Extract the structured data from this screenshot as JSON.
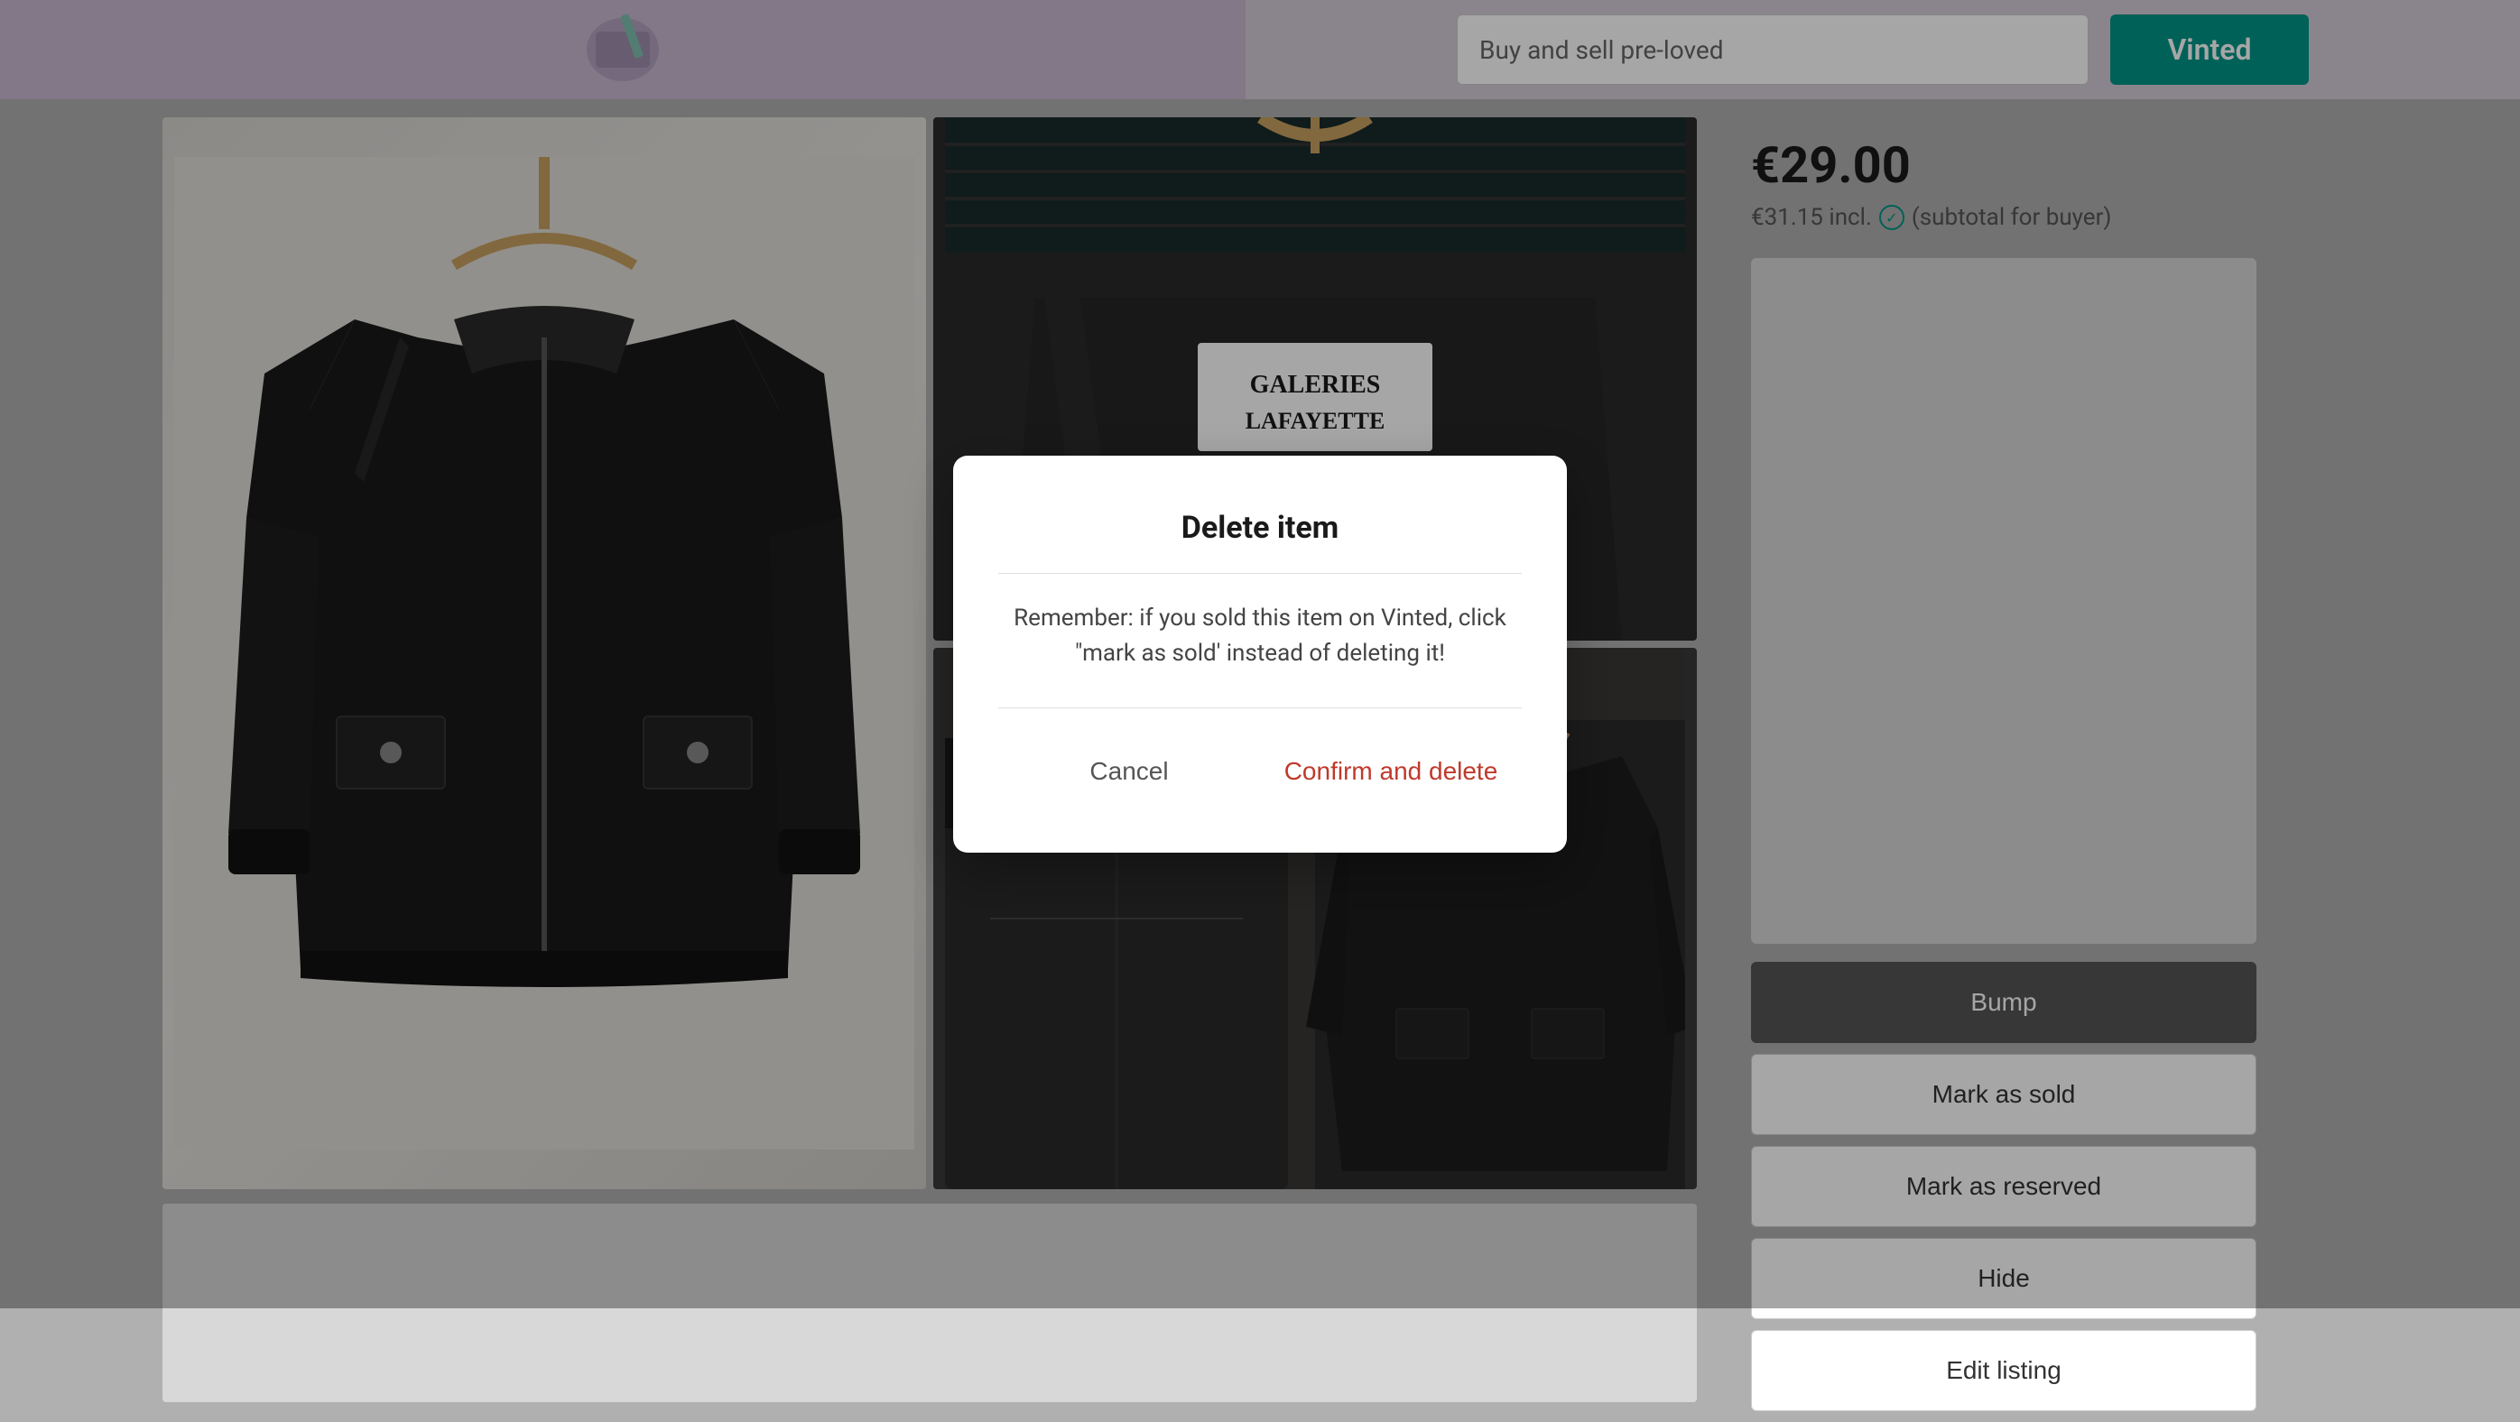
{
  "banner": {
    "buy_sell_placeholder": "Buy and sell pre-loved",
    "vinted_label": "Vinted"
  },
  "product": {
    "price": "€29.00",
    "subtotal": "€31.15 incl.",
    "subtotal_suffix": "(subtotal for buyer)"
  },
  "sidebar": {
    "bump_label": "Bump",
    "mark_as_sold_label": "Mark as sold",
    "mark_as_reserved_label": "Mark as reserved",
    "hide_label": "Hide",
    "edit_listing_label": "Edit listing"
  },
  "modal": {
    "title": "Delete item",
    "body": "Remember: if you sold this item on Vinted, click \"mark as sold' instead of deleting it!",
    "cancel_label": "Cancel",
    "confirm_label": "Confirm and delete"
  },
  "label": {
    "galeries": "GALERIES",
    "lafayette": "LAFAYETTE"
  }
}
